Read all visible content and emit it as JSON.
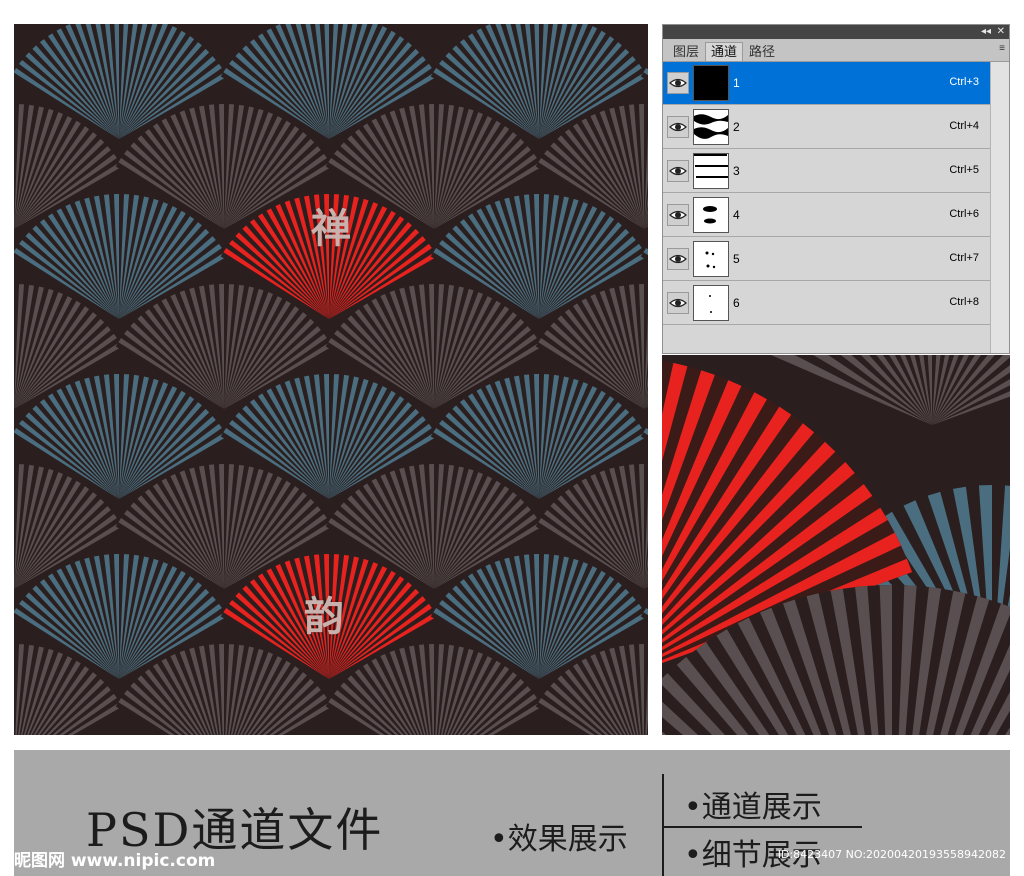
{
  "panel": {
    "tabs": [
      {
        "label": "图层",
        "active": false
      },
      {
        "label": "通道",
        "active": true
      },
      {
        "label": "路径",
        "active": false
      }
    ],
    "title_controls": [
      "◂◂",
      "✕"
    ],
    "menu_icon": "≡",
    "channels": [
      {
        "name": "1",
        "shortcut": "Ctrl+3",
        "selected": true,
        "thumb": "black"
      },
      {
        "name": "2",
        "shortcut": "Ctrl+4",
        "selected": false,
        "thumb": "bands"
      },
      {
        "name": "3",
        "shortcut": "Ctrl+5",
        "selected": false,
        "thumb": "noise"
      },
      {
        "name": "4",
        "shortcut": "Ctrl+6",
        "selected": false,
        "thumb": "blobs"
      },
      {
        "name": "5",
        "shortcut": "Ctrl+7",
        "selected": false,
        "thumb": "specks"
      },
      {
        "name": "6",
        "shortcut": "Ctrl+8",
        "selected": false,
        "thumb": "dots"
      }
    ],
    "eye_icon": "eye-icon"
  },
  "pattern": {
    "calligraphy": [
      "禅",
      "韵"
    ],
    "colors": {
      "dark": "#2a1f1e",
      "grey": "#5a4f50",
      "blue": "#4a6e80",
      "red": "#e8221e"
    }
  },
  "footer": {
    "title": "PSD通道文件",
    "label_effect": "•效果展示",
    "label_channel": "•通道展示",
    "label_detail": "•细节展示"
  },
  "watermark": {
    "logo": "昵图网 www.nipic.com",
    "id": "ID:8423407 NO:20200420193558942082"
  }
}
